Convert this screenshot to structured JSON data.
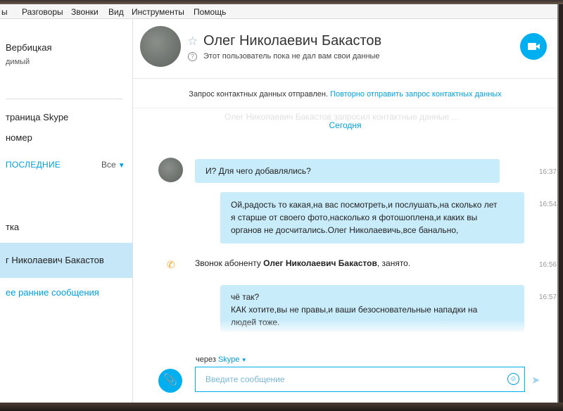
{
  "menu": [
    "ы",
    "Разговоры",
    "Звонки",
    "Вид",
    "Инструменты",
    "Помощь"
  ],
  "sidebar": {
    "user_name": "Вербицкая",
    "user_status": "димый",
    "skype_page": "траница Skype",
    "number": "номер",
    "recent_label": "ПОСЛЕДНИЕ",
    "filter_label": "Все",
    "item_a": "тка",
    "selected_contact": "г Николаевич Бакастов",
    "earlier_messages": "ее ранние сообщения"
  },
  "header": {
    "contact_name": "Олег Николаевич Бакастов",
    "status": "Этот пользователь пока не дал вам свои данные"
  },
  "notice": {
    "sent": "Запрос контактных данных отправлен.",
    "resend": "Повторно отправить запрос контактных данных",
    "ghost": "Олег Николаевич Бакастов запросил контактные данные ..."
  },
  "today": "Сегодня",
  "messages": [
    {
      "text": "И? Для чего добавлялись?",
      "time": "16:37"
    },
    {
      "lines": [
        "Ой,радость то какая,на вас посмотреть,и послушать,на сколько лет",
        "я старше от своего фото,насколько я фотошоплена,и каких вы",
        "органов не досчитались.Олег Николаевичь,все банально,"
      ],
      "time": "16:54"
    },
    {
      "lines": [
        "чё так?",
        "КАК хотите,вы не правы,и ваши безосновательные нападки на",
        "людей тоже."
      ],
      "time": "16:57"
    }
  ],
  "call": {
    "prefix": "Звонок абоненту",
    "name": "Олег Николаевич Бакастов",
    "suffix": ", занято.",
    "time": "16:56"
  },
  "compose": {
    "via": "через",
    "via_service": "Skype",
    "placeholder": "Введите сообщение"
  },
  "colors": {
    "accent": "#00aff0",
    "bubble": "#c9ecfa",
    "selected": "#c6e7f7"
  }
}
